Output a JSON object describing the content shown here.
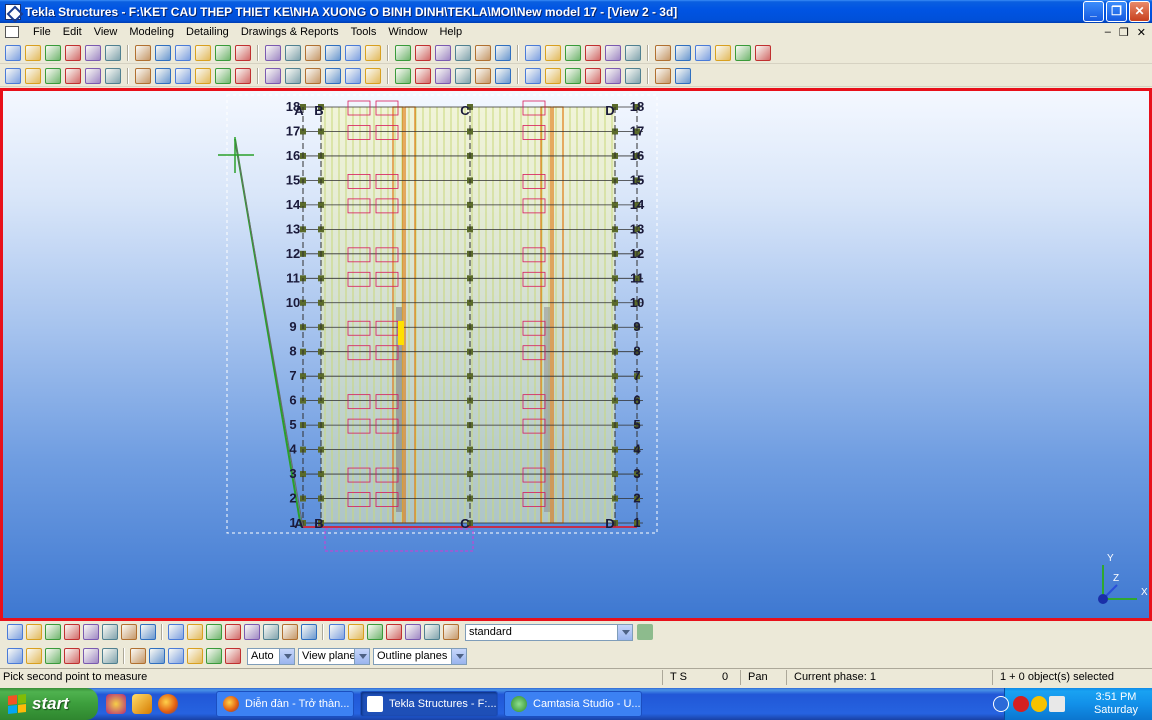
{
  "window": {
    "title": "Tekla Structures - F:\\KET CAU THEP THIET KE\\NHA XUONG O BINH DINH\\TEKLA\\MOI\\New model 17 - [View 2 - 3d]",
    "minimize": "_",
    "maximize": "❐",
    "close": "✕"
  },
  "menu": {
    "items": [
      "File",
      "Edit",
      "View",
      "Modeling",
      "Detailing",
      "Drawings & Reports",
      "Tools",
      "Window",
      "Help"
    ],
    "mdi_min": "–",
    "mdi_restore": "❐",
    "mdi_close": "✕"
  },
  "icons": {
    "toolbar1": [
      "new-icon",
      "open-icon",
      "save-icon",
      "undo-icon",
      "redo-icon",
      "copy-icon",
      "paste-icon",
      "delete-icon",
      "properties-icon",
      "window-icon",
      "window-icon",
      "window-icon",
      "cut-icon",
      "select-icon",
      "beam-icon",
      "plate-icon",
      "part-icon",
      "part-icon",
      "pencil-icon",
      "wizard-icon",
      "wizard-icon",
      "help-icon",
      "grid-icon",
      "snap-icon",
      "snap-icon",
      "snap-icon",
      "snap-icon",
      "measure-icon",
      "component-icon",
      "component-icon",
      "table-icon",
      "export-icon",
      "globe-icon",
      "arrows-icon",
      "tool-icon",
      "tool-icon"
    ],
    "toolbar2": [
      "pointer-icon",
      "rotate-icon",
      "rotate-icon",
      "part-icon",
      "part-icon",
      "column-icon",
      "beam-icon",
      "beam-icon",
      "plate-icon",
      "plate-icon",
      "bolt-icon",
      "weld-icon",
      "mesh-icon",
      "point-icon",
      "point-icon",
      "point-icon",
      "point-icon",
      "point-icon",
      "circle-icon",
      "binoculars-icon",
      "view-icon",
      "view-icon",
      "view-icon",
      "view-icon",
      "view-icon",
      "view-icon",
      "line-icon",
      "line-icon",
      "line-icon",
      "line-icon",
      "bolt-icon",
      "tool-icon"
    ],
    "bottom1": [
      "select-all-icon",
      "select-part-icon",
      "select-icon",
      "select-icon",
      "select-icon",
      "select-icon",
      "select-icon",
      "select-icon",
      "select-icon",
      "select-icon",
      "select-icon",
      "select-icon",
      "select-icon",
      "select-icon",
      "select-icon",
      "select-icon",
      "select-icon",
      "select-icon",
      "snap-icon",
      "snap-icon",
      "snap-icon",
      "snap-icon",
      "snap-icon"
    ],
    "bottom2": [
      "snap-end-icon",
      "snap-mid-icon",
      "snap-circle-icon",
      "snap-triangle-icon",
      "snap-x-icon",
      "snap-dim-icon",
      "snap-sigma-icon",
      "snap-arc-icon",
      "snap-check-icon",
      "snap-arrow-icon",
      "snap-lock-icon",
      "snap-filter-icon"
    ]
  },
  "view": {
    "grid_letters": [
      "A",
      "B",
      "C",
      "D"
    ],
    "grid_numbers": [
      "1",
      "2",
      "3",
      "4",
      "5",
      "6",
      "7",
      "8",
      "9",
      "10",
      "11",
      "12",
      "13",
      "14",
      "15",
      "16",
      "17",
      "18"
    ],
    "colors": {
      "frame": "#e8101a",
      "grid": "#2f2f2f",
      "columns": "#c8a400",
      "beams": "#d81a5a",
      "orange": "#e07a10",
      "green": "#2aa02a"
    },
    "axis": {
      "x": "X",
      "y": "Y",
      "z": "Z"
    }
  },
  "bottom_toolbar": {
    "selection_filter": "standard",
    "snap_depth": "Auto",
    "plane": "View plane",
    "planes": "Outline planes"
  },
  "status": {
    "prompt": "Pick second point to measure",
    "ts": "T S",
    "count": "0",
    "mode": "Pan",
    "phase": "Current phase: 1",
    "selected": "1 + 0 object(s) selected"
  },
  "taskbar": {
    "start": "start",
    "tasks": [
      {
        "label": "Diễn đàn - Trở thàn...",
        "color": "#e8801c"
      },
      {
        "label": "Tekla Structures - F:...",
        "color": "#ffffff"
      },
      {
        "label": "Camtasia Studio - U...",
        "color": "#3dab3d"
      }
    ],
    "time": "3:51 PM",
    "day": "Saturday"
  }
}
